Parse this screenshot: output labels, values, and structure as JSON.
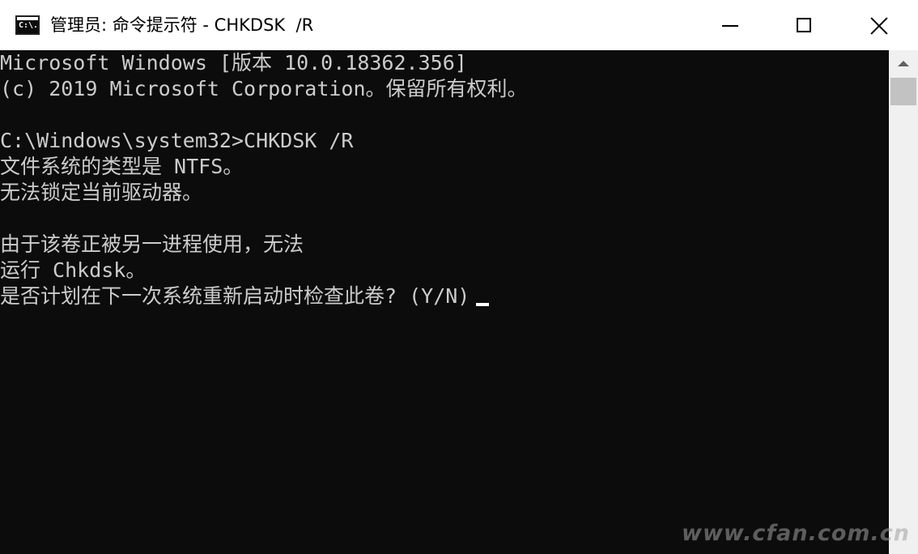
{
  "window": {
    "title": "管理员: 命令提示符 - CHKDSK  /R",
    "icon": "cmd-icon",
    "icon_text": "C:\\.",
    "controls": [
      "minimize-icon",
      "maximize-icon",
      "close-icon"
    ]
  },
  "console": {
    "lines": [
      "Microsoft Windows [版本 10.0.18362.356]",
      "(c) 2019 Microsoft Corporation。保留所有权利。",
      "",
      "C:\\Windows\\system32>CHKDSK /R",
      "文件系统的类型是 NTFS。",
      "无法锁定当前驱动器。",
      "",
      "由于该卷正被另一进程使用，无法",
      "运行 Chkdsk。",
      "是否计划在下一次系统重新启动时检查此卷? (Y/N)"
    ]
  },
  "watermark": "www.cfan.com.cn",
  "colors": {
    "console_bg": "#0c0c0c",
    "console_text": "#cccccc",
    "titlebar_bg": "#ffffff",
    "scrollbar_bg": "#f0f0f0"
  }
}
